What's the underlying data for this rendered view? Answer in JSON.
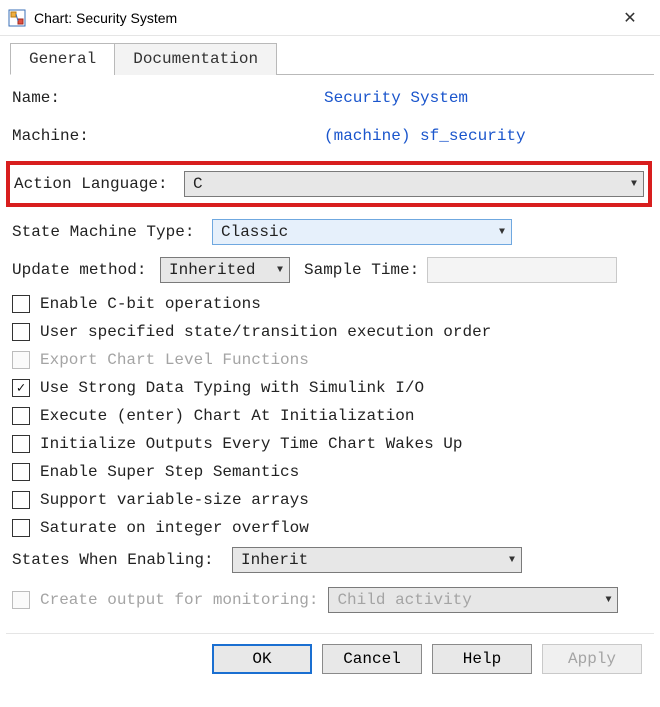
{
  "window": {
    "title": "Chart: Security System"
  },
  "tabs": {
    "general": "General",
    "documentation": "Documentation"
  },
  "fields": {
    "name_label": "Name:",
    "name_value": "Security System",
    "machine_label": "Machine:",
    "machine_value": "(machine) sf_security",
    "action_lang_label": "Action Language:",
    "action_lang_value": "C",
    "state_machine_type_label": "State Machine Type:",
    "state_machine_type_value": "Classic",
    "update_method_label": "Update method:",
    "update_method_value": "Inherited",
    "sample_time_label": "Sample Time:",
    "sample_time_value": "",
    "states_when_enabling_label": "States When Enabling:",
    "states_when_enabling_value": "Inherit",
    "create_output_label": "Create output for monitoring:",
    "create_output_value": "Child activity"
  },
  "checks": {
    "enable_cbit": "Enable C-bit operations",
    "user_specified": "User specified state/transition execution order",
    "export_funcs": "Export Chart Level Functions",
    "strong_typing": "Use Strong Data Typing with Simulink I/O",
    "exec_init": "Execute (enter) Chart At Initialization",
    "init_outputs": "Initialize Outputs Every Time Chart Wakes Up",
    "super_step": "Enable Super Step Semantics",
    "var_size": "Support variable-size arrays",
    "saturate": "Saturate on integer overflow"
  },
  "buttons": {
    "ok": "OK",
    "cancel": "Cancel",
    "help": "Help",
    "apply": "Apply"
  }
}
